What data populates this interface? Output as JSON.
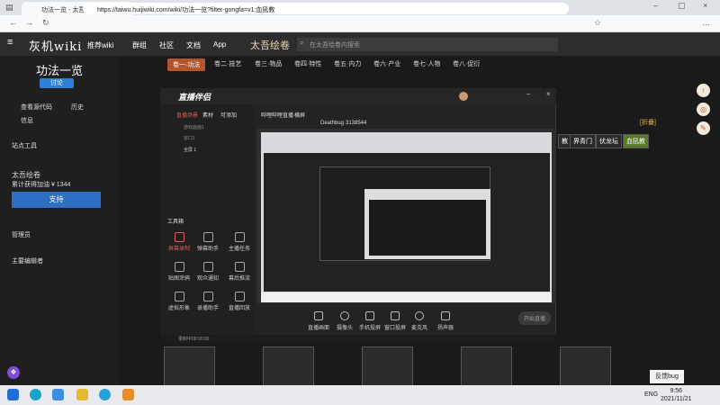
{
  "browser": {
    "tab_title": "功法一览 - 太吾绘卷资料攻略百科",
    "url": "https://taiwu.huijiwiki.com/wiki/功法一览?filter-gongfa=v1:血犼教"
  },
  "site": {
    "logo": "灰机wiki",
    "nav": [
      "推荐wiki",
      "群组",
      "社区",
      "文档",
      "App",
      "太吾绘卷"
    ],
    "search_placeholder": "在太吾绘卷内搜索"
  },
  "sidebar": {
    "title": "功法一览",
    "tag": "讨论",
    "links": [
      "查看源代码",
      "历史",
      "信息"
    ],
    "section_tools": "站点工具",
    "wiki_name": "太吾绘卷",
    "donation": "累计获得加油 ¥ 1344",
    "support_label": "支持",
    "manage_label": "管理员",
    "editors_label": "主要编辑者"
  },
  "categories": [
    "卷一·功法",
    "卷二·技艺",
    "卷三·物品",
    "卷四·特性",
    "卷五·内力",
    "卷六·产业",
    "卷七·人物",
    "卷八·促衍"
  ],
  "right_links": [
    "[折叠]",
    "教",
    "界青门",
    "伏龙坛",
    "血犼教"
  ],
  "recorder": {
    "brand": "直播伴侣",
    "tabs": [
      "直播场景",
      "素材",
      "可添加"
    ],
    "scenes": [
      "游戏画面1",
      "窗口1",
      "全屏 1"
    ],
    "toolbar_label": "工具箱",
    "tools": [
      "屏幕录制",
      "弹幕助手",
      "主播任务",
      "贴图涂鸦",
      "观众通知",
      "幕后推流",
      "虚拟形象",
      "录播助手",
      "直播回放"
    ],
    "preview_header": [
      "哔哩哔哩直播",
      "横屏",
      "Deathbug",
      "3138544"
    ],
    "controls": [
      "直播画面",
      "摄像头",
      "手机投屏",
      "窗口投屏",
      "麦克风",
      "扬声器"
    ],
    "start_label": "开始直播",
    "status": "录制中00:00:00"
  },
  "feedback_label": "反馈bug",
  "taskbar": {
    "time": "9:56",
    "date": "2021/11/21",
    "lang": "ENG"
  }
}
